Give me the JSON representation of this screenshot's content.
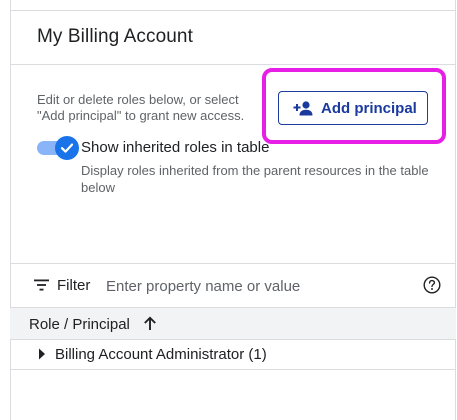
{
  "header": {
    "title": "My Billing Account"
  },
  "intro": {
    "description": "Edit or delete roles below, or select \"Add principal\" to grant new access.",
    "add_button_label": "Add principal"
  },
  "inherited_toggle": {
    "label": "Show inherited roles in table",
    "help": "Display roles inherited from the parent resources in the table below",
    "checked": true
  },
  "filter": {
    "label": "Filter",
    "placeholder": "Enter property name or value",
    "value": ""
  },
  "table": {
    "column_header": "Role / Principal",
    "rows": [
      {
        "label": "Billing Account Administrator (1)"
      }
    ]
  },
  "colors": {
    "accent": "#1a73e8",
    "button_text": "#1a3a9e",
    "highlight": "#e61ee6"
  },
  "icons": {
    "add_button": "person-add-icon",
    "toggle_knob": "check-icon",
    "filter": "filter-list-icon",
    "help": "help-circle-icon",
    "sort": "arrow-up-icon",
    "row_expander": "triangle-right-icon"
  }
}
